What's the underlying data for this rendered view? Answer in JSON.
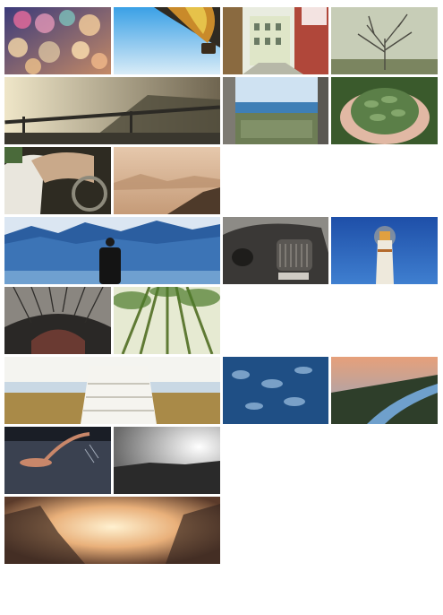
{
  "gallery": {
    "photos": [
      {
        "id": 1,
        "subject": "bokeh-lights"
      },
      {
        "id": 2,
        "subject": "hot-air-balloon-sky"
      },
      {
        "id": 3,
        "subject": "street-with-buildings"
      },
      {
        "id": 4,
        "subject": "bare-tree"
      },
      {
        "id": 5,
        "subject": "railing-sunlight-landscape"
      },
      {
        "id": 6,
        "subject": "sea-view-from-window"
      },
      {
        "id": 7,
        "subject": "hands-holding-greenery"
      },
      {
        "id": 8,
        "subject": "person-driving-car"
      },
      {
        "id": 9,
        "subject": "misty-mountains"
      },
      {
        "id": 10,
        "subject": "man-facing-mountains-lake"
      },
      {
        "id": 11,
        "subject": "vintage-car"
      },
      {
        "id": 12,
        "subject": "lighthouse-blue-sky"
      },
      {
        "id": 13,
        "subject": "train-station-roof"
      },
      {
        "id": 14,
        "subject": "bamboo-forest"
      },
      {
        "id": 15,
        "subject": "wooden-stairs-to-beach"
      },
      {
        "id": 16,
        "subject": "blue-sky-through-leaves"
      },
      {
        "id": 17,
        "subject": "coastal-road-sunset"
      },
      {
        "id": 18,
        "subject": "swimmer-in-water"
      },
      {
        "id": 19,
        "subject": "black-white-sunburst-landscape"
      },
      {
        "id": 20,
        "subject": "sunset-field-glow"
      }
    ]
  }
}
